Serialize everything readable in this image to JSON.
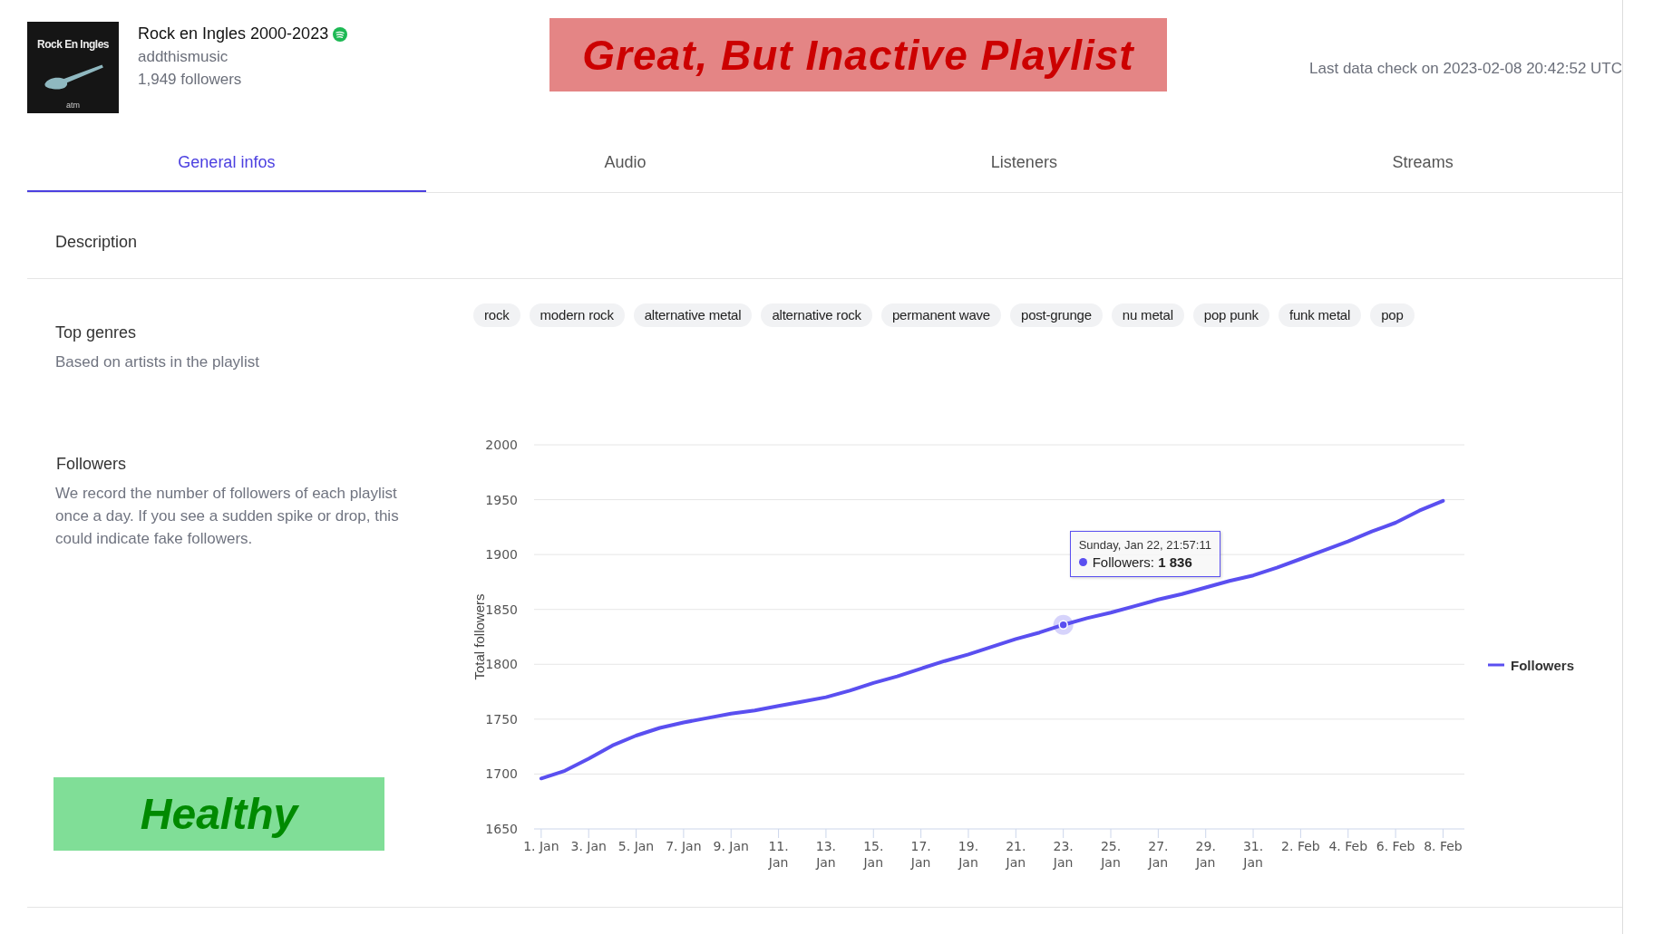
{
  "playlist": {
    "cover_text": "Rock En Ingles",
    "cover_logo": "atm",
    "title": "Rock en Ingles 2000-2023",
    "owner": "addthismusic",
    "followers": "1,949 followers"
  },
  "verdict_banner": {
    "text": "Great, But Inactive Playlist"
  },
  "last_check": "Last data check on 2023-02-08 20:42:52 UTC",
  "tabs": [
    {
      "label": "General infos",
      "selected": true
    },
    {
      "label": "Audio",
      "selected": false
    },
    {
      "label": "Listeners",
      "selected": false
    },
    {
      "label": "Streams",
      "selected": false
    }
  ],
  "sections": [
    {
      "kind": "plain",
      "title": "Description"
    },
    {
      "kind": "genres",
      "title": "Top genres",
      "subtitle": "Based on artists in the playlist",
      "genres": [
        "rock",
        "modern rock",
        "alternative metal",
        "alternative rock",
        "permanent wave",
        "post-grunge",
        "nu metal",
        "pop punk",
        "funk metal",
        "pop"
      ]
    },
    {
      "kind": "chart",
      "title": "Followers",
      "subtitle": "We record the number of followers of each playlist once a day. If you see a sudden spike or drop, this could indicate fake followers.",
      "health_badge": "Healthy",
      "tooltip": {
        "date": "Sunday, Jan 22, 21:57:11",
        "series": "Followers:",
        "value": "1 836",
        "category": "23. Jan"
      },
      "chart_data": {
        "type": "line",
        "grid": true,
        "ylabel": "Total followers",
        "ylim": [
          1650,
          2000
        ],
        "yticks": [
          1650,
          1700,
          1750,
          1800,
          1850,
          1900,
          1950,
          2000
        ],
        "categories": [
          "1. Jan",
          null,
          "3. Jan",
          null,
          "5. Jan",
          null,
          "7. Jan",
          null,
          "9. Jan",
          null,
          "11. Jan",
          null,
          "13. Jan",
          null,
          "15. Jan",
          null,
          "17. Jan",
          null,
          "19. Jan",
          null,
          "21. Jan",
          null,
          "23. Jan",
          null,
          "25. Jan",
          null,
          "27. Jan",
          null,
          "29. Jan",
          null,
          "31. Jan",
          null,
          "2. Feb",
          null,
          "4. Feb",
          null,
          "6. Feb",
          null,
          "8. Feb"
        ],
        "series": [
          {
            "name": "Followers",
            "color": "#5a4ff0",
            "values": [
              1696,
              1703,
              1714,
              1726,
              1735,
              1742,
              1747,
              1751,
              1755,
              1758,
              1762,
              1766,
              1770,
              1776,
              1783,
              1789,
              1796,
              1803,
              1809,
              1816,
              1823,
              1829,
              1836,
              1842,
              1847,
              1853,
              1859,
              1864,
              1870,
              1876,
              1881,
              1888,
              1896,
              1904,
              1912,
              1921,
              1929,
              1940,
              1949
            ]
          }
        ]
      }
    }
  ]
}
